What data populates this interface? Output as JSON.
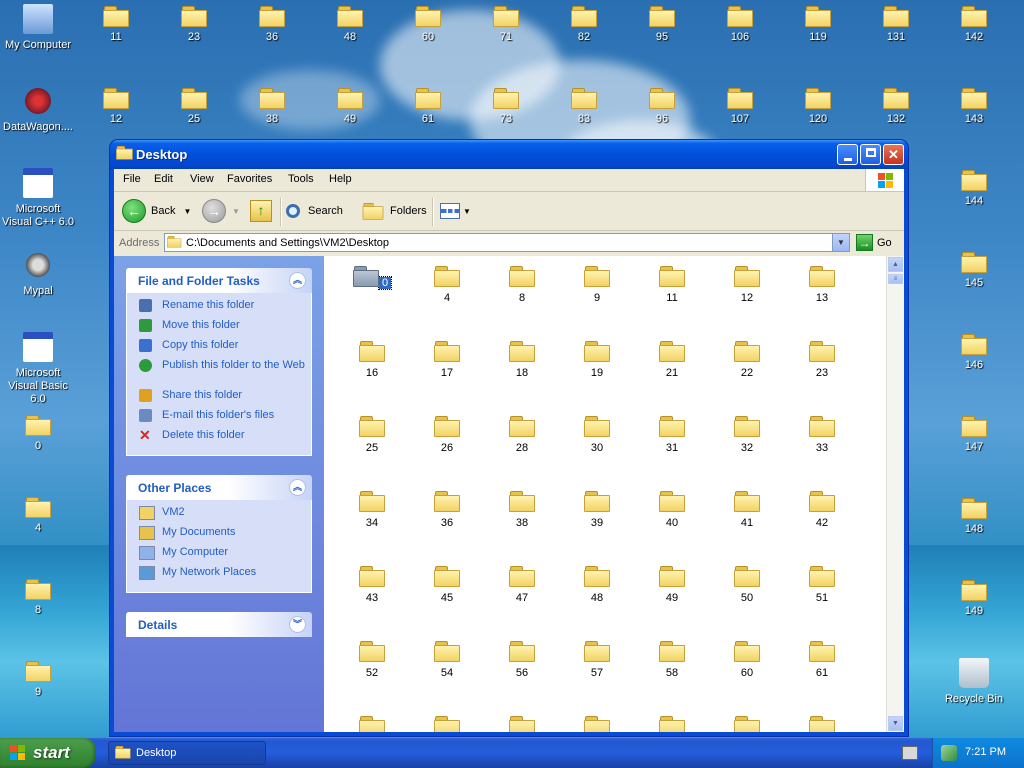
{
  "desktop": {
    "system_icons": [
      {
        "label": "My Computer",
        "icon": "computer-icon"
      },
      {
        "label": "DataWagon....",
        "icon": "datawagon-shortcut-icon"
      },
      {
        "label": "Microsoft Visual C++ 6.0",
        "icon": "app-shortcut-icon"
      },
      {
        "label": "Mypal",
        "icon": "mypal-raccoon-icon"
      },
      {
        "label": "Microsoft Visual Basic 6.0",
        "icon": "app-shortcut-icon"
      }
    ],
    "left_folders": [
      "0",
      "4",
      "8",
      "9"
    ],
    "top_row1": [
      "11",
      "23",
      "36",
      "48",
      "60",
      "71",
      "82",
      "95",
      "106",
      "119",
      "131",
      "142"
    ],
    "top_row2": [
      "12",
      "25",
      "38",
      "49",
      "61",
      "73",
      "83",
      "96",
      "107",
      "120",
      "132",
      "143"
    ],
    "right_column": [
      "144",
      "145",
      "146",
      "147",
      "148",
      "149"
    ],
    "recycle_bin": "Recycle Bin"
  },
  "window": {
    "title": "Desktop",
    "menu": [
      "File",
      "Edit",
      "View",
      "Favorites",
      "Tools",
      "Help"
    ],
    "toolbar": {
      "back": "Back",
      "search": "Search",
      "folders": "Folders"
    },
    "address": {
      "label": "Address",
      "value": "C:\\Documents and Settings\\VM2\\Desktop",
      "go": "Go"
    },
    "tasks_panel": {
      "title": "File and Folder Tasks",
      "items": [
        "Rename this folder",
        "Move this folder",
        "Copy this folder",
        "Publish this folder to the Web",
        "Share this folder",
        "E-mail this folder's files",
        "Delete this folder"
      ]
    },
    "other_places": {
      "title": "Other Places",
      "items": [
        "VM2",
        "My Documents",
        "My Computer",
        "My Network Places"
      ]
    },
    "details": {
      "title": "Details"
    },
    "folders": [
      "0",
      "4",
      "8",
      "9",
      "11",
      "12",
      "13",
      "16",
      "17",
      "18",
      "19",
      "21",
      "22",
      "23",
      "25",
      "26",
      "28",
      "30",
      "31",
      "32",
      "33",
      "34",
      "36",
      "38",
      "39",
      "40",
      "41",
      "42",
      "43",
      "45",
      "47",
      "48",
      "49",
      "50",
      "51",
      "52",
      "54",
      "56",
      "57",
      "58",
      "60",
      "61",
      "",
      "",
      "",
      "",
      "",
      "",
      ""
    ],
    "selected_folder": "0"
  },
  "taskbar": {
    "start": "start",
    "task_button": "Desktop",
    "clock": "7:21 PM"
  },
  "colors": {
    "titlebar": "#0050dc",
    "taskbar": "#245ddb",
    "start_green": "#3c8f3c",
    "panel_link": "#215dc6",
    "selection": "#316ac5"
  }
}
